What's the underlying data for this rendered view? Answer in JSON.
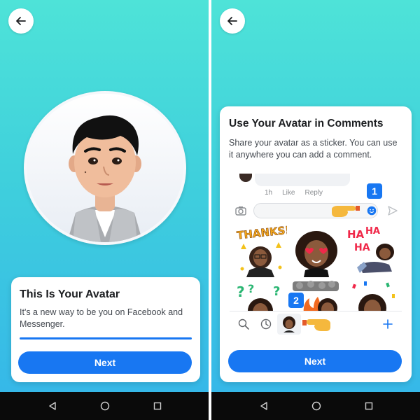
{
  "colors": {
    "accent": "#1877f2",
    "gradient_top": "#4ee3d8",
    "gradient_bottom": "#36b8e8",
    "card_bg": "#ffffff",
    "navbar_bg": "#0a0a0a"
  },
  "left_screen": {
    "back_icon": "arrow-left-icon",
    "card": {
      "title": "This Is Your Avatar",
      "description": "It's a new way to be you on Facebook and Messenger.",
      "progress": 1.0,
      "next_label": "Next"
    }
  },
  "right_screen": {
    "back_icon": "arrow-left-icon",
    "card": {
      "title": "Use Your Avatar in Comments",
      "description": "Share your avatar as a sticker. You can use it anywhere you can add a comment.",
      "next_label": "Next"
    },
    "illustration": {
      "comment_meta": {
        "time": "1h",
        "like": "Like",
        "reply": "Reply"
      },
      "step_badges": [
        "1",
        "2"
      ],
      "sticker_texts": {
        "thanks": "THANKS!",
        "haha": "HA"
      },
      "icons": [
        "camera-icon",
        "smiley-icon",
        "send-icon",
        "pointing-hand-icon",
        "search-icon",
        "clock-icon",
        "plus-icon"
      ]
    }
  },
  "navbar": {
    "icons": [
      "back-triangle-icon",
      "home-circle-icon",
      "recents-square-icon"
    ]
  }
}
